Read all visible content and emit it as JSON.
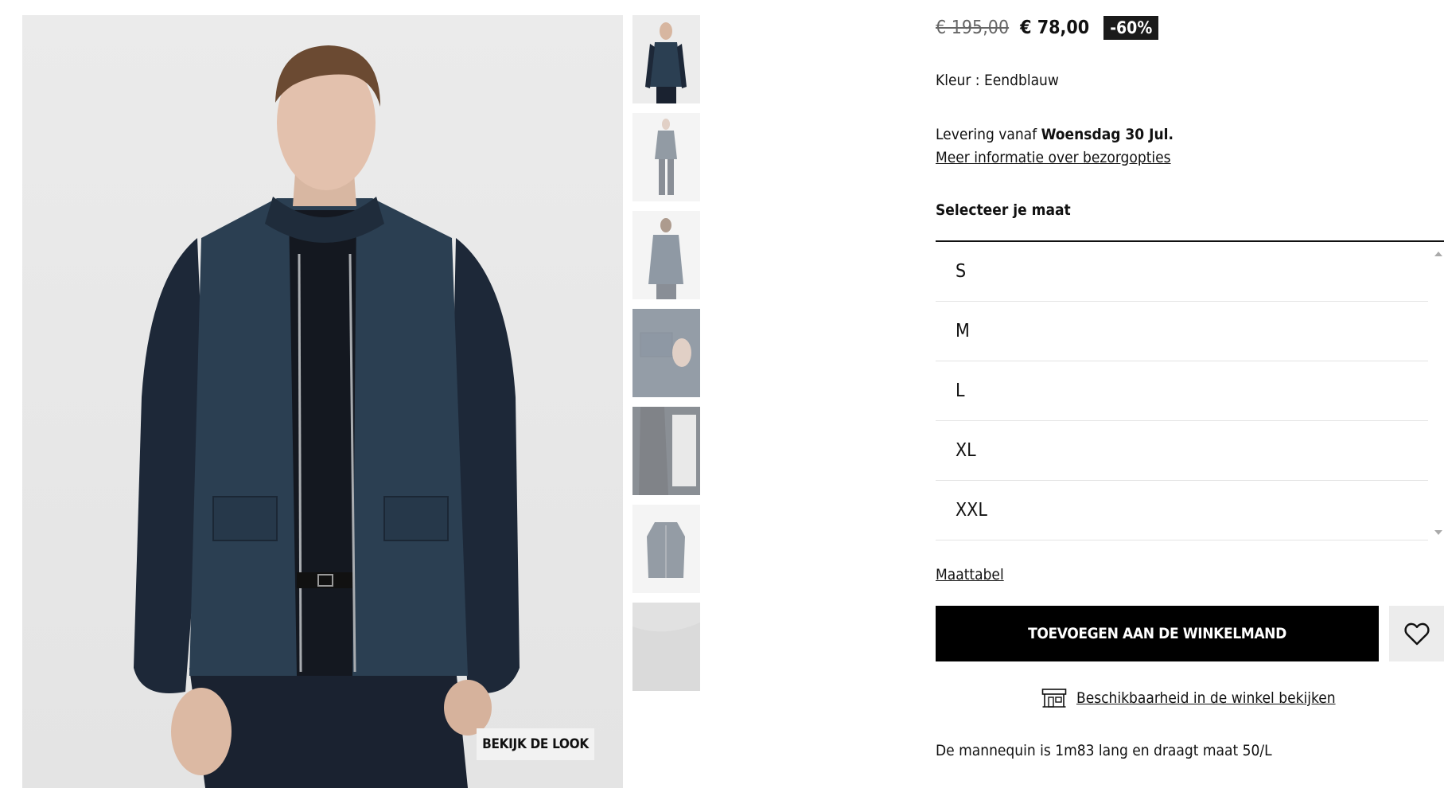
{
  "gallery": {
    "look_button_label": "BEKIJK DE LOOK",
    "thumbnails": [
      {
        "icon": "jacket-front-thumbnail"
      },
      {
        "icon": "full-body-thumbnail"
      },
      {
        "icon": "back-view-thumbnail"
      },
      {
        "icon": "pocket-detail-thumbnail"
      },
      {
        "icon": "inner-lining-thumbnail"
      },
      {
        "icon": "flat-lay-thumbnail"
      },
      {
        "icon": "fabric-detail-thumbnail"
      }
    ]
  },
  "product": {
    "old_price": "€ 195,00",
    "new_price": "€ 78,00",
    "discount": "-60%",
    "color_label": "Kleur : Eendblauw",
    "delivery_prefix": "Levering vanaf",
    "delivery_date": "Woensdag 30 Jul.",
    "delivery_link": "Meer informatie over bezorgopties",
    "size_heading": "Selecteer je maat",
    "sizes": [
      "S",
      "M",
      "L",
      "XL",
      "XXL"
    ],
    "size_table_link": "Maattabel",
    "add_to_cart_label": "TOEVOEGEN AAN DE WINKELMAND",
    "store_link": "Beschikbaarheid in de winkel bekijken",
    "mannequin_text": "De mannequin is 1m83 lang en draagt maat 50/L"
  },
  "colors": {
    "jacket": "#2b3f52",
    "sleeve": "#1d2838",
    "cta_bg": "#000000",
    "badge_bg": "#1a1a1a"
  }
}
